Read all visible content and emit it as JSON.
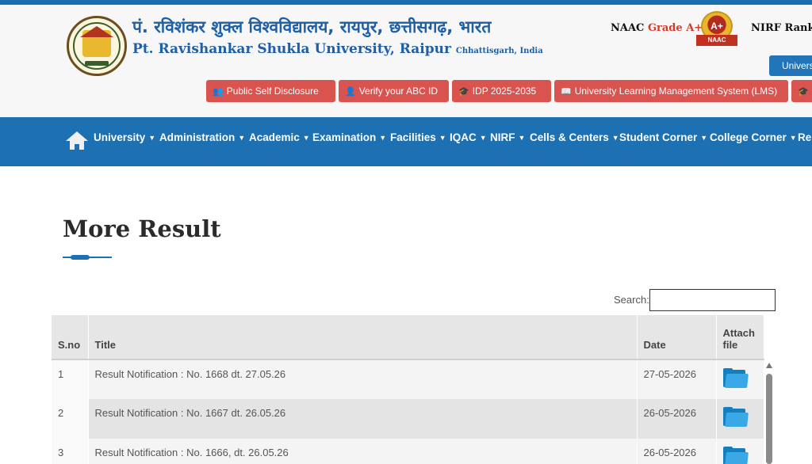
{
  "header": {
    "title_hindi": "पं. रविशंकर शुक्ल विश्वविद्यालय, रायपुर, छत्तीसगढ़, भारत",
    "title_english": "Pt. Ravishankar Shukla University, Raipur",
    "title_state": "Chhattisgarh, India",
    "naac_label": "NAAC",
    "naac_grade": "Grade A+",
    "naac_badge_text": "A+",
    "naac_badge_caption": "NAAC",
    "nirf_text": "NIRF Ranke",
    "university_button": "Univers"
  },
  "quick_links": [
    {
      "label": "Public Self Disclosure",
      "icon": "users-icon",
      "glyph": "👥"
    },
    {
      "label": "Verify your ABC ID",
      "icon": "user-icon",
      "glyph": "👤"
    },
    {
      "label": "IDP 2025-2035",
      "icon": "cap-icon",
      "glyph": "🎓"
    },
    {
      "label": "University Learning Management System (LMS)",
      "icon": "book-icon",
      "glyph": "📖"
    },
    {
      "label": "",
      "icon": "cap-icon",
      "glyph": "🎓"
    }
  ],
  "nav": {
    "items": [
      "University",
      "Administration",
      "Academic",
      "Examination",
      "Facilities",
      "IQAC",
      "NIRF",
      "Cells & Centers",
      "Student Corner",
      "College Corner",
      "Re"
    ]
  },
  "page": {
    "title": "More Result"
  },
  "search": {
    "label": "Search:",
    "value": ""
  },
  "table": {
    "headers": {
      "sno": "S.no",
      "title": "Title",
      "date": "Date",
      "attach": "Attach file"
    },
    "rows": [
      {
        "sno": "1",
        "title": "Result Notification : No. 1668 dt. 27.05.26",
        "date": "27-05-2026"
      },
      {
        "sno": "2",
        "title": "Result Notification : No. 1667 dt. 26.05.26",
        "date": "26-05-2026"
      },
      {
        "sno": "3",
        "title": "Result Notification : No. 1666, dt. 26.05.26",
        "date": "26-05-2026"
      }
    ]
  },
  "colors": {
    "brand_blue": "#1d70b1",
    "quick_link_red": "#d9534f",
    "folder_blue": "#137fbf"
  }
}
